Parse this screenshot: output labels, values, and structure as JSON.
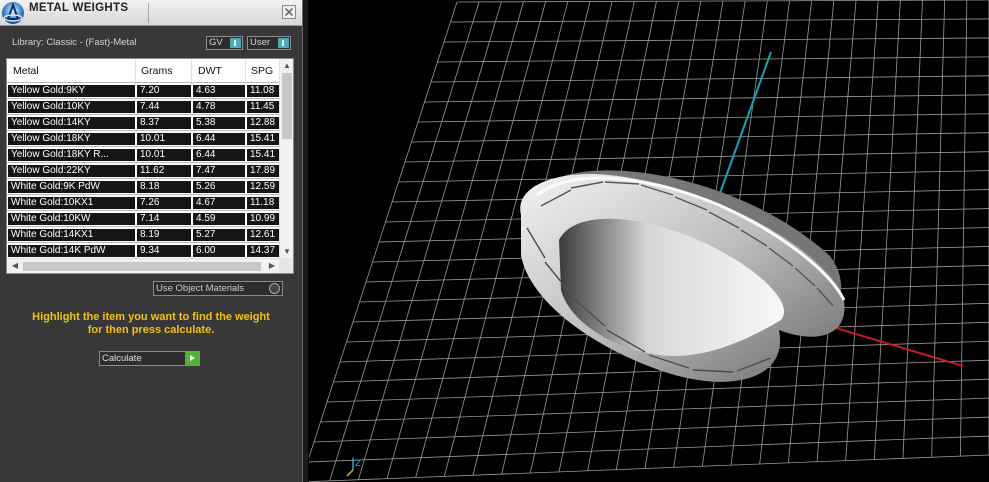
{
  "panel": {
    "title": "METAL WEIGHTS",
    "library_label": "Library: Classic - (Fast)-Metal",
    "gv_label": "GV",
    "user_label": "User",
    "columns": [
      "Metal",
      "Grams",
      "DWT",
      "SPG"
    ],
    "rows": [
      [
        "Yellow Gold:9KY",
        "7.20",
        "4.63",
        "11.08"
      ],
      [
        "Yellow Gold:10KY",
        "7.44",
        "4.78",
        "11.45"
      ],
      [
        "Yellow Gold:14KY",
        "8.37",
        "5.38",
        "12.88"
      ],
      [
        "Yellow Gold:18KY",
        "10.01",
        "6.44",
        "15.41"
      ],
      [
        "Yellow Gold:18KY R...",
        "10.01",
        "6.44",
        "15.41"
      ],
      [
        "Yellow Gold:22KY",
        "11.62",
        "7.47",
        "17.89"
      ],
      [
        "White Gold:9K PdW",
        "8.18",
        "5.26",
        "12.59"
      ],
      [
        "White Gold:10KX1",
        "7.26",
        "4.67",
        "11.18"
      ],
      [
        "White Gold:10KW",
        "7.14",
        "4.59",
        "10.99"
      ],
      [
        "White Gold:14KX1",
        "8.19",
        "5.27",
        "12.61"
      ],
      [
        "White Gold:14K PdW",
        "9.34",
        "6.00",
        "14.37"
      ]
    ],
    "use_object_materials_label": "Use Object Materials",
    "hint_line1": "Highlight the item you want to find the weight",
    "hint_line2": "for then press calculate.",
    "calculate_label": "Calculate"
  },
  "viewport": {
    "axis_label": "Z",
    "colors": {
      "z_axis": "#1aa3b0",
      "x_axis": "#c81a1a",
      "grid": "#9a9a9a",
      "hint": "#f0c21b",
      "go_button": "#52b232"
    }
  }
}
